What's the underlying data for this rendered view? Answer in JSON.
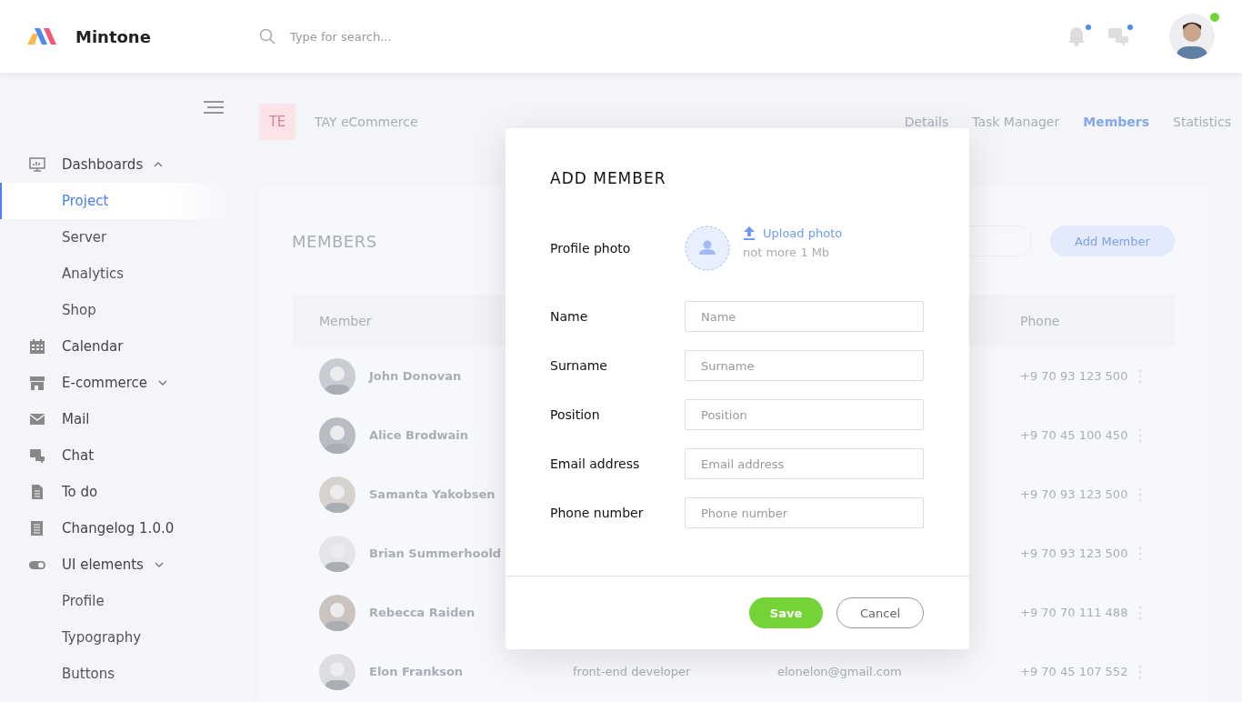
{
  "app": {
    "name": "Mintone"
  },
  "search": {
    "placeholder": "Type for search..."
  },
  "header_icons": [
    {
      "kind": "bell",
      "badge": true
    },
    {
      "kind": "chat",
      "badge": true
    }
  ],
  "user": {
    "online": true
  },
  "sidebar": {
    "items": [
      {
        "label": "Dashboards",
        "expanded": true,
        "selected": false,
        "children": [
          {
            "label": "Project",
            "selected": true
          },
          {
            "label": "Server",
            "selected": false
          },
          {
            "label": "Analytics",
            "selected": false
          },
          {
            "label": "Shop",
            "selected": false
          }
        ]
      },
      {
        "label": "Calendar",
        "selected": false
      },
      {
        "label": "E-commerce",
        "expanded": false,
        "selected": false
      },
      {
        "label": "Mail",
        "selected": false
      },
      {
        "label": "Chat",
        "selected": false
      },
      {
        "label": "To do",
        "selected": false
      },
      {
        "label": "Changelog 1.0.0",
        "selected": false
      },
      {
        "label": "UI elements",
        "expanded": false,
        "selected": false,
        "children": [
          {
            "label": "Profile",
            "selected": false
          },
          {
            "label": "Typography",
            "selected": false
          },
          {
            "label": "Buttons",
            "selected": false
          }
        ]
      }
    ]
  },
  "project": {
    "initials": "TE",
    "name": "TAY eCommerce",
    "tabs": [
      {
        "label": "Details",
        "selected": false
      },
      {
        "label": "Task Manager",
        "selected": false
      },
      {
        "label": "Members",
        "selected": true
      },
      {
        "label": "Statistics",
        "selected": false
      }
    ]
  },
  "members": {
    "title": "MEMBERS",
    "add_button": "Add Member",
    "columns": [
      "Member",
      "Phone"
    ],
    "rows": [
      {
        "name": "John Donovan",
        "phone": "+9 70 93 123 500"
      },
      {
        "name": "Alice Brodwain",
        "phone": "+9 70 45 100 450"
      },
      {
        "name": "Samanta Yakobsen",
        "phone": "+9 70 93 123 500"
      },
      {
        "name": "Brian Summerhoold",
        "phone": "+9 70 93 123 500"
      },
      {
        "name": "Rebecca Raiden",
        "phone": "+9 70 70 111 488"
      },
      {
        "name": "Elon Frankson",
        "position": "front-end developer",
        "email": "elonelon@gmail.com",
        "phone": "+9 70 45 107 552"
      }
    ]
  },
  "modal": {
    "title": "ADD MEMBER",
    "photo": {
      "label": "Profile photo",
      "upload": "Upload photo",
      "hint": "not more 1 Mb"
    },
    "fields": [
      {
        "label": "Name",
        "placeholder": "Name"
      },
      {
        "label": "Surname",
        "placeholder": "Surname"
      },
      {
        "label": "Position",
        "placeholder": "Position"
      },
      {
        "label": "Email address",
        "placeholder": "Email address"
      },
      {
        "label": "Phone number",
        "placeholder": "Phone number"
      }
    ],
    "buttons": [
      {
        "label": "Save",
        "kind": "primary"
      },
      {
        "label": "Cancel",
        "kind": "secondary"
      }
    ]
  }
}
